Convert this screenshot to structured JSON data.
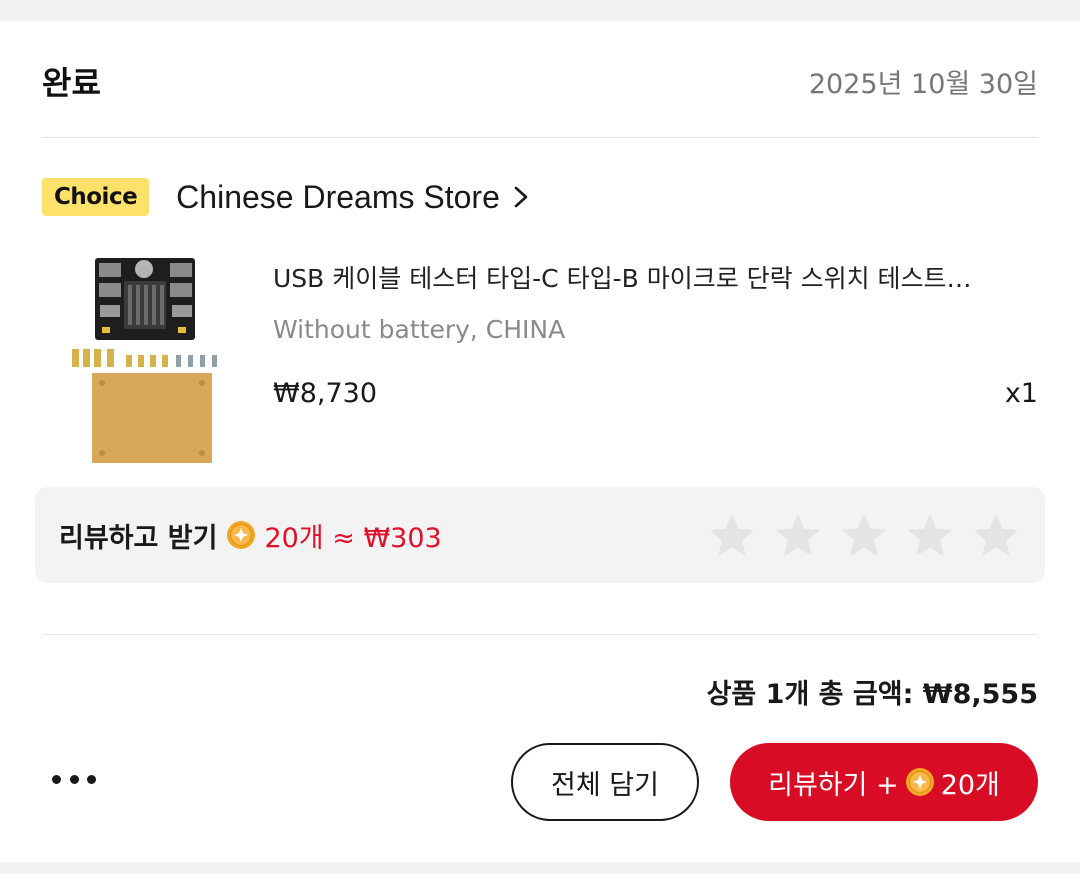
{
  "order": {
    "status": "완료",
    "date": "2025년 10월 30일"
  },
  "store": {
    "badge": "Choice",
    "name": "Chinese Dreams Store"
  },
  "product": {
    "title": "USB 케이블 테스터 타입-C 타입-B 마이크로 단락 스위치 테스트…",
    "variant": "Without battery, CHINA",
    "price": "₩8,730",
    "quantity": "x1"
  },
  "review_reward": {
    "label": "리뷰하고 받기",
    "amount": "20개 ≈ ₩303",
    "rating": 0,
    "max_rating": 5
  },
  "summary": {
    "total": "상품 1개 총 금액: ₩8,555"
  },
  "actions": {
    "add_all_label": "전체 담기",
    "review_label": "리뷰하기 +",
    "review_reward": "20개"
  },
  "colors": {
    "accent_red": "#d80c24",
    "choice_yellow": "#fde16a",
    "coin_orange": "#f5a623",
    "star_inactive": "#e4e4e4"
  },
  "icons": {
    "store_chevron": "chevron-right-icon",
    "coin": "coin-icon",
    "star": "star-icon",
    "more": "more-icon"
  }
}
